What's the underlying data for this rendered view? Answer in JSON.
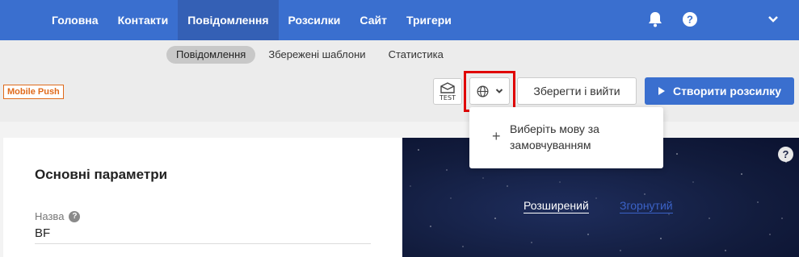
{
  "nav": {
    "items": [
      {
        "label": "Головна"
      },
      {
        "label": "Контакти"
      },
      {
        "label": "Повідомлення"
      },
      {
        "label": "Розсилки"
      },
      {
        "label": "Сайт"
      },
      {
        "label": "Тригери"
      }
    ],
    "active_index": 2,
    "icons": [
      "bell-icon",
      "help-icon",
      "chevron-down-icon"
    ]
  },
  "subnav": {
    "items": [
      {
        "label": "Повідомлення"
      },
      {
        "label": "Збережені шаблони"
      },
      {
        "label": "Статистика"
      }
    ],
    "active_index": 0
  },
  "toolbar": {
    "badge": "Mobile Push",
    "test_label": "TEST",
    "save_label": "Зберегти і вийти",
    "create_label": "Створити розсилку"
  },
  "language_dropdown": {
    "add_default_label": "Виберіть мову за замовчуванням"
  },
  "main": {
    "section_title": "Основні параметри",
    "name_label": "Назва",
    "name_value": "BF"
  },
  "preview": {
    "tab_extended": "Розширений",
    "tab_collapsed": "Згорнутий"
  },
  "colors": {
    "nav_bg": "#3a6fcf",
    "primary_button": "#3a6fcf",
    "badge": "#e06a1b",
    "highlight_border": "#e00000"
  }
}
